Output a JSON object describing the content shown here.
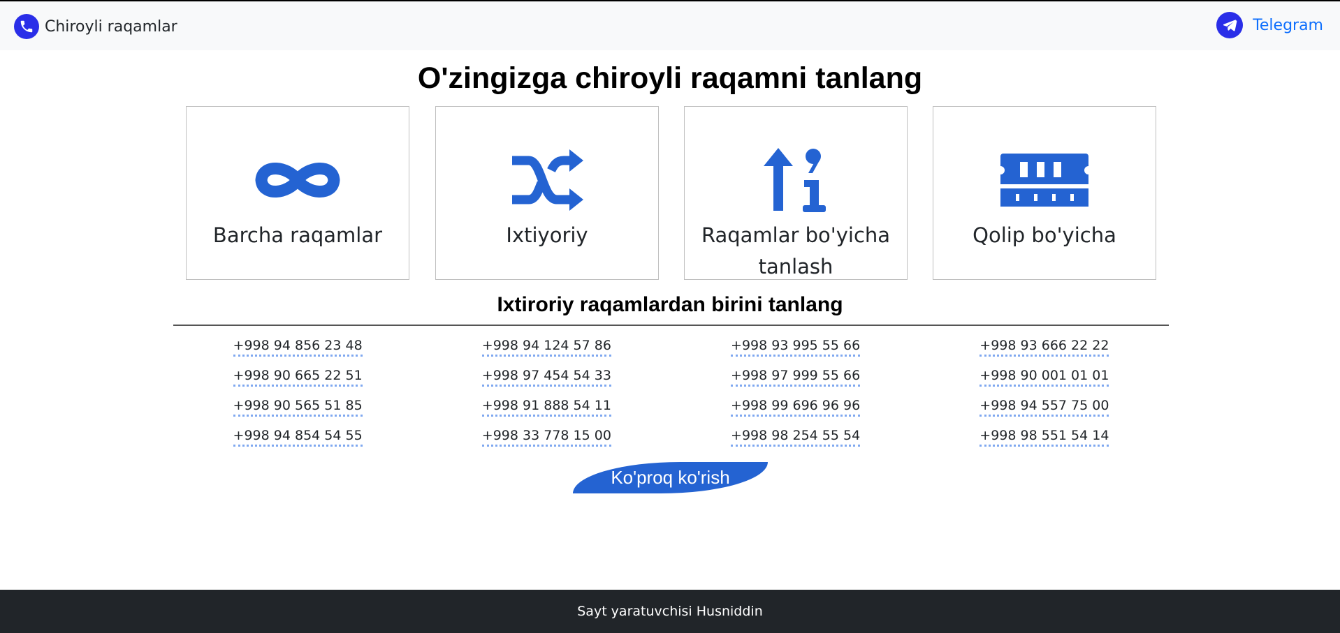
{
  "navbar": {
    "brand_icon": "phone-icon",
    "brand_label": "Chiroyli raqamlar",
    "telegram_icon": "telegram-icon",
    "telegram_label": "Telegram"
  },
  "main": {
    "heading": "O'zingizga chiroyli raqamni tanlang",
    "cards": [
      {
        "icon": "infinity-icon",
        "label": "Barcha raqamlar"
      },
      {
        "icon": "shuffle-icon",
        "label": "Ixtiyoriy"
      },
      {
        "icon": "sort-numeric-up-icon",
        "label": "Raqamlar bo'yicha tanlash"
      },
      {
        "icon": "memory-icon",
        "label": "Qolip bo'yicha"
      }
    ],
    "subheading": "Ixtiroriy raqamlardan birini tanlang",
    "numbers": [
      [
        "+998 94 856 23 48",
        "+998 94 124 57 86",
        "+998 93 995 55 66",
        "+998 93 666 22 22"
      ],
      [
        "+998 90 665 22 51",
        "+998 97 454 54 33",
        "+998 97 999 55 66",
        "+998 90 001 01 01"
      ],
      [
        "+998 90 565 51 85",
        "+998 91 888 54 11",
        "+998 99 696 96 96",
        "+998 94 557 75 00"
      ],
      [
        "+998 94 854 54 55",
        "+998 33 778 15 00",
        "+998 98 254 55 54",
        "+998 98 551 54 14"
      ]
    ],
    "more_button": "Ko'proq ko'rish"
  },
  "footer": {
    "text": "Sayt yaratuvchisi Husniddin"
  },
  "colors": {
    "accent": "#2463d2",
    "nav_icon": "#2a2ee8",
    "link": "#0d6efd",
    "footer_bg": "#212529"
  }
}
